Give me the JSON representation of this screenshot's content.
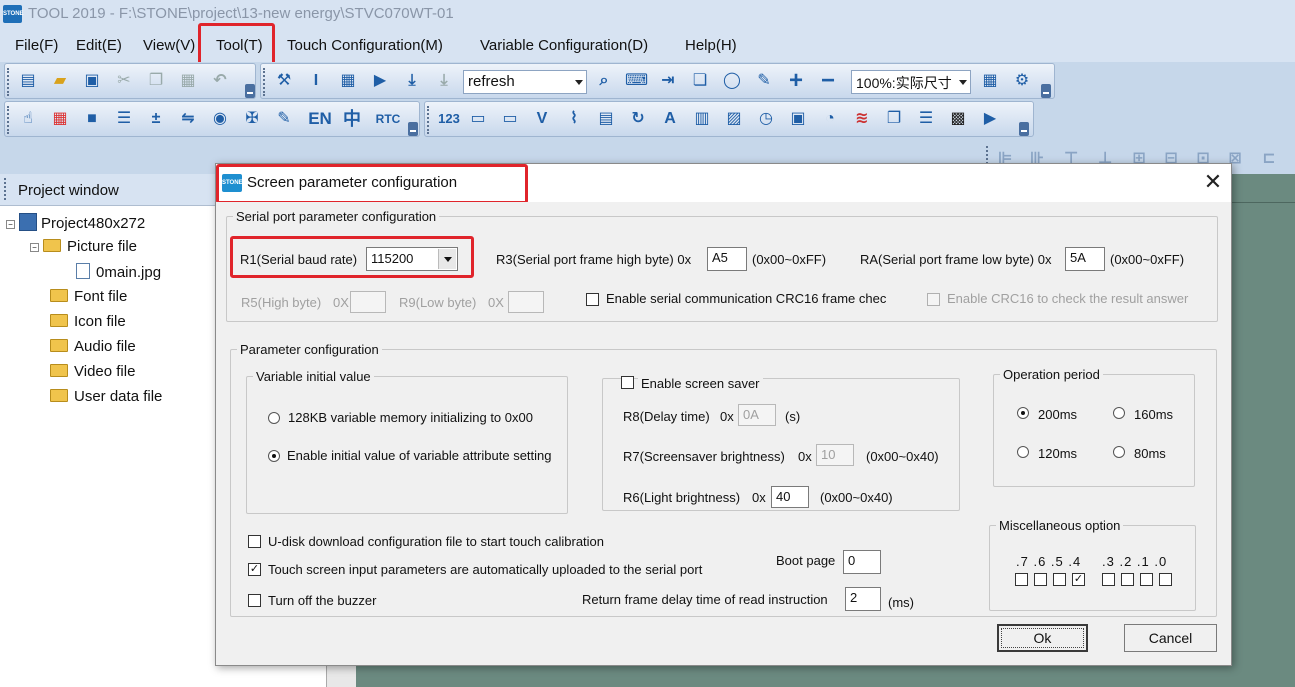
{
  "app": {
    "logo_text": "STONE",
    "window_title": "TOOL 2019 - F:\\STONE\\project\\13-new energy\\STVC070WT-01"
  },
  "menu": [
    "File(F)",
    "Edit(E)",
    "View(V)",
    "Tool(T)",
    "Touch Configuration(M)",
    "Variable Configuration(D)",
    "Help(H)"
  ],
  "toolbar": {
    "refresh_combo": "refresh",
    "zoom_combo": "100%:实际尺寸",
    "en_label": "EN",
    "zh_label": "中",
    "rtc_label": "RTC",
    "num_label": "123"
  },
  "project_window": {
    "title": "Project window",
    "root": "Project480x272",
    "items": [
      {
        "label": "Picture file"
      },
      {
        "label": "0main.jpg"
      },
      {
        "label": "Font file"
      },
      {
        "label": "Icon file"
      },
      {
        "label": "Audio file"
      },
      {
        "label": "Video file"
      },
      {
        "label": "User data file"
      }
    ]
  },
  "dialog": {
    "logo_text": "STONE",
    "title": "Screen parameter configuration",
    "close": "✕",
    "serial": {
      "legend": "Serial port parameter configuration",
      "r1_label": "R1(Serial baud rate)",
      "r1_value": "115200",
      "r3_label": "R3(Serial port frame high byte) 0x",
      "r3_value": "A5",
      "r3_range": "(0x00~0xFF)",
      "ra_label": "RA(Serial port frame low byte) 0x",
      "ra_value": "5A",
      "ra_range": "(0x00~0xFF)",
      "r5_label": "R5(High byte)",
      "r5_prefix": "0X",
      "r9_label": "R9(Low byte)",
      "r9_prefix": "0X",
      "crc16_label": "Enable serial communication CRC16 frame chec",
      "crc16_result_label": "Enable CRC16 to check the result answer"
    },
    "params": {
      "legend": "Parameter configuration",
      "var_init_legend": "Variable initial value",
      "opt_128kb": "128KB variable memory initializing to 0x00",
      "opt_attr": "Enable initial value of variable attribute setting",
      "saver_label": "Enable screen saver",
      "r8_label": "R8(Delay time)",
      "r8_prefix": "0x",
      "r8_value": "0A",
      "r8_unit": "(s)",
      "r7_label": "R7(Screensaver brightness)",
      "r7_prefix": "0x",
      "r7_value": "10",
      "r7_range": "(0x00~0x40)",
      "r6_label": "R6(Light brightness)",
      "r6_prefix": "0x",
      "r6_value": "40",
      "r6_range": "(0x00~0x40)",
      "op_legend": "Operation period",
      "op_200": "200ms",
      "op_160": "160ms",
      "op_120": "120ms",
      "op_80": "80ms",
      "udisk_label": "U-disk download configuration file to start touch calibration",
      "touch_upload_label": "Touch screen input parameters are automatically uploaded to the serial port",
      "buzzer_label": "Turn off the buzzer",
      "boot_label": "Boot page",
      "boot_value": "0",
      "delay_label": "Return frame delay time of read instruction",
      "delay_value": "2",
      "delay_unit": "(ms)",
      "misc_legend": "Miscellaneous option",
      "misc_bits_high": ".7 .6 .5 .4",
      "misc_bits_low": ".3 .2 .1 .0",
      "misc_checked_bit": ".4"
    },
    "ok": "Ok",
    "cancel": "Cancel"
  },
  "highlight_color": "#e0242b"
}
